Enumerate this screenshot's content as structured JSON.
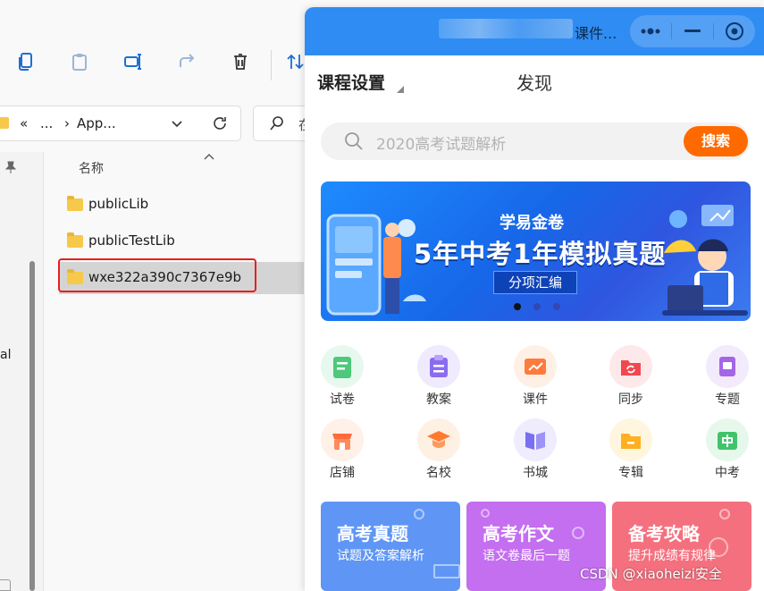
{
  "explorer": {
    "address": {
      "chevrons": "«",
      "ellipsis": "...",
      "arrow": "›",
      "folder": "App..."
    },
    "search_partial": "在",
    "column_name": "名称",
    "nav_partial_text": "al",
    "files": [
      {
        "name": "publicLib",
        "selected": false
      },
      {
        "name": "publicTestLib",
        "selected": false
      },
      {
        "name": "wxe322a390c7367e9b",
        "selected": true
      }
    ],
    "toolbar_icons": [
      "copy-icon",
      "paste-icon",
      "rename-icon",
      "share-icon",
      "delete-icon",
      "sort-icon"
    ]
  },
  "panel": {
    "title": "课件...",
    "tabs": {
      "settings": "课程设置",
      "discover": "发现"
    },
    "search": {
      "placeholder": "2020高考试题解析",
      "button": "搜索"
    },
    "banner": {
      "subtitle": "学易金卷",
      "title": "5年中考1年模拟真题",
      "tag": "分项汇编",
      "dots": 3,
      "active_dot": 0
    },
    "grid": [
      {
        "label": "试卷",
        "icon": "paper-icon",
        "color": "#4cc97a",
        "bg": "#e7f8ee"
      },
      {
        "label": "教案",
        "icon": "lesson-plan-icon",
        "color": "#8a6cf0",
        "bg": "#efeafd"
      },
      {
        "label": "课件",
        "icon": "courseware-icon",
        "color": "#ff7a3d",
        "bg": "#fff0e6"
      },
      {
        "label": "同步",
        "icon": "sync-icon",
        "color": "#f2474f",
        "bg": "#fde9ea"
      },
      {
        "label": "专题",
        "icon": "topic-icon",
        "color": "#a266e6",
        "bg": "#f3eafc"
      },
      {
        "label": "店铺",
        "icon": "shop-icon",
        "color": "#ff6b3a",
        "bg": "#fff0e8"
      },
      {
        "label": "名校",
        "icon": "school-icon",
        "color": "#ff7a2e",
        "bg": "#fff0e4"
      },
      {
        "label": "书城",
        "icon": "bookstore-icon",
        "color": "#7a6ff0",
        "bg": "#eeecfd"
      },
      {
        "label": "专辑",
        "icon": "album-icon",
        "color": "#ffb020",
        "bg": "#fff6e0"
      },
      {
        "label": "中考",
        "icon": "exam-icon",
        "color": "#3fc46a",
        "bg": "#e6f8ec"
      }
    ],
    "cards": [
      {
        "title": "高考真题",
        "subtitle": "试题及答案解析",
        "color": "#5f96f5"
      },
      {
        "title": "高考作文",
        "subtitle": "语文卷最后一题",
        "color": "#c46ef0"
      },
      {
        "title": "备考攻略",
        "subtitle": "提升成绩有规律",
        "color": "#f5707e"
      }
    ]
  },
  "watermark": "CSDN @xiaoheizi安全"
}
